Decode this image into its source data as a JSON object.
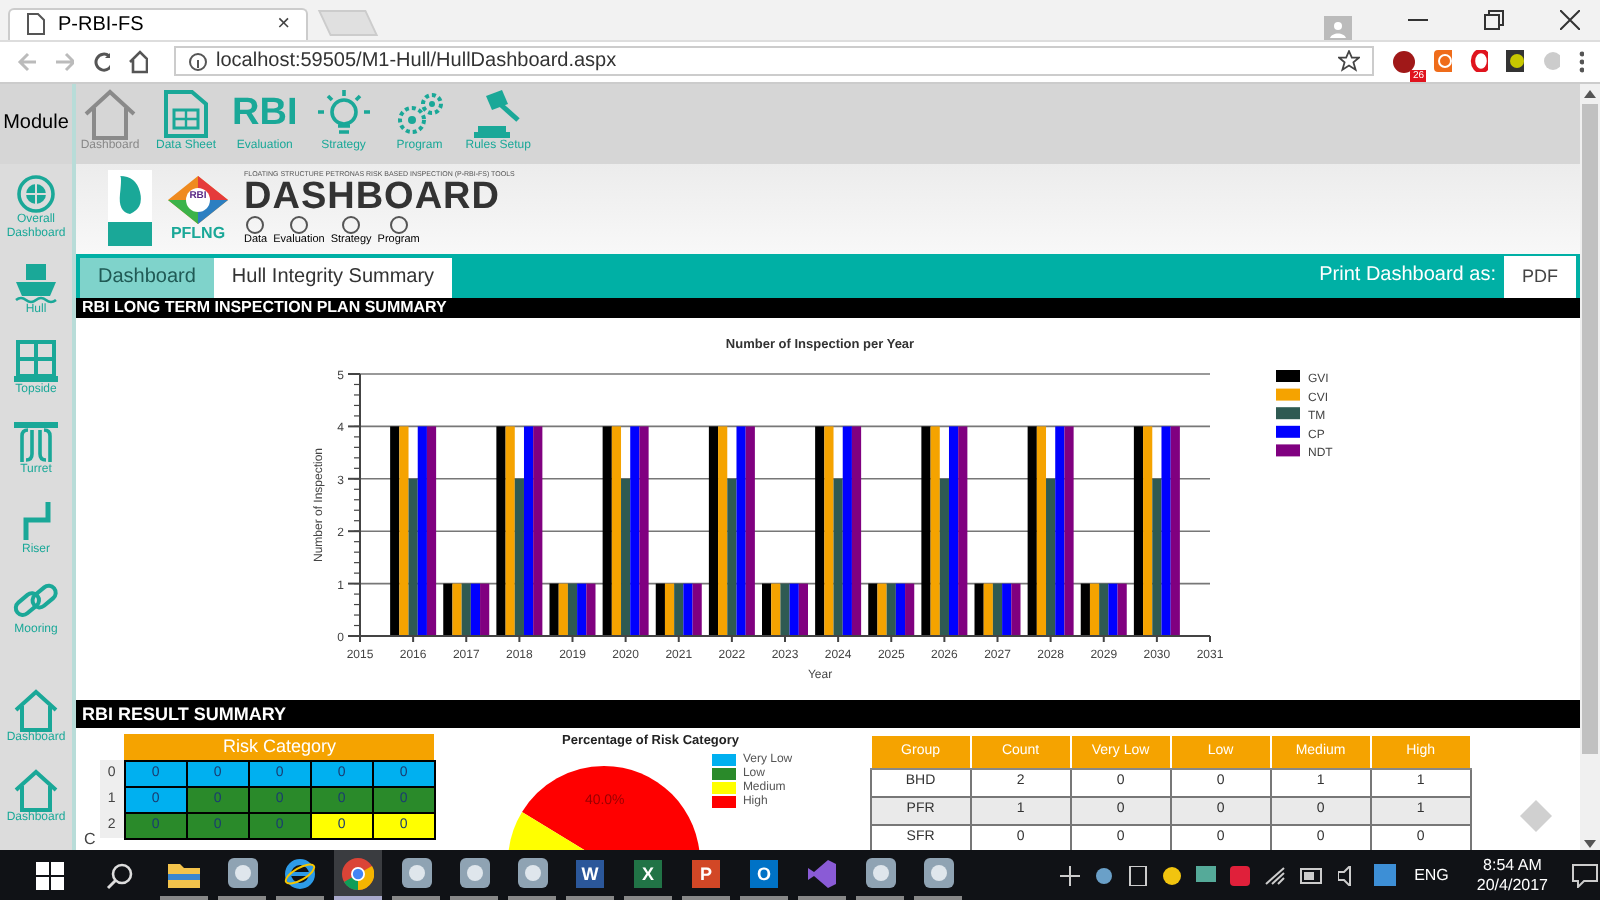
{
  "browser": {
    "tab_title": "P-RBI-FS",
    "tab_close": "×",
    "url": "localhost:59505/M1-Hull/HullDashboard.aspx",
    "extension_badge": "26"
  },
  "module_label": "Module",
  "toolbar": [
    {
      "label": "Dashboard",
      "kind": "house"
    },
    {
      "label": "Data Sheet",
      "kind": "sheet"
    },
    {
      "label": "Evaluation",
      "kind": "rbi",
      "logo_text": "RBI"
    },
    {
      "label": "Strategy",
      "kind": "bulb"
    },
    {
      "label": "Program",
      "kind": "gears"
    },
    {
      "label": "Rules Setup",
      "kind": "gavel"
    }
  ],
  "sidebar": {
    "items": [
      {
        "label": "Overall Dashboard",
        "kind": "globe"
      },
      {
        "label": "Hull",
        "kind": "ship"
      },
      {
        "label": "Topside",
        "kind": "window"
      },
      {
        "label": "Turret",
        "kind": "turret"
      },
      {
        "label": "Riser",
        "kind": "pipe"
      },
      {
        "label": "Mooring",
        "kind": "chain"
      },
      {
        "label": "Dashboard",
        "kind": "house"
      },
      {
        "label": "Dashboard",
        "kind": "house"
      }
    ]
  },
  "banner": {
    "logo_badge": "RBI",
    "logo_name": "PFLNG",
    "subtitle": "FLOATING STRUCTURE PETRONAS RISK BASED INSPECTION (P-RBI-FS) TOOLS",
    "title": "DASHBOARD",
    "steps": [
      "Data",
      "Evaluation",
      "Strategy",
      "Program"
    ]
  },
  "tabs": [
    {
      "label": "Dashboard",
      "selected": false
    },
    {
      "label": "Hull Integrity Summary",
      "selected": true
    }
  ],
  "print": {
    "label": "Print Dashboard as:",
    "button": "PDF"
  },
  "plan_section": {
    "title": "RBI LONG TERM INSPECTION PLAN SUMMARY",
    "chart_data": {
      "type": "bar",
      "title": "Number of Inspection per Year",
      "xlabel": "Year",
      "ylabel": "Number of Inspection",
      "x": [
        2016,
        2017,
        2018,
        2019,
        2020,
        2021,
        2022,
        2023,
        2024,
        2025,
        2026,
        2027,
        2028,
        2029,
        2030
      ],
      "series": [
        {
          "name": "GVI",
          "color": "#000000",
          "values": [
            4,
            1,
            4,
            1,
            4,
            1,
            4,
            1,
            4,
            1,
            4,
            1,
            4,
            1,
            4
          ]
        },
        {
          "name": "CVI",
          "color": "#f5a300",
          "values": [
            4,
            1,
            4,
            1,
            4,
            1,
            4,
            1,
            4,
            1,
            4,
            1,
            4,
            1,
            4
          ]
        },
        {
          "name": "TM",
          "color": "#2f5a52",
          "values": [
            3,
            1,
            3,
            1,
            3,
            1,
            3,
            1,
            3,
            1,
            3,
            1,
            3,
            1,
            3
          ]
        },
        {
          "name": "CP",
          "color": "#0000ff",
          "values": [
            4,
            1,
            4,
            1,
            4,
            1,
            4,
            1,
            4,
            1,
            4,
            1,
            4,
            1,
            4
          ]
        },
        {
          "name": "NDT",
          "color": "#800080",
          "values": [
            4,
            1,
            4,
            1,
            4,
            1,
            4,
            1,
            4,
            1,
            4,
            1,
            4,
            1,
            4
          ]
        }
      ],
      "xlim": [
        2015,
        2031
      ],
      "xticks": [
        2015,
        2016,
        2017,
        2018,
        2019,
        2020,
        2021,
        2022,
        2023,
        2024,
        2025,
        2026,
        2027,
        2028,
        2029,
        2030,
        2031
      ],
      "ylim": [
        0,
        5
      ],
      "yticks": [
        0,
        1,
        2,
        3,
        4,
        5
      ],
      "grid": true,
      "legend": true
    }
  },
  "result_section": {
    "title": "RBI RESULT SUMMARY",
    "risk_matrix": {
      "title": "Risk Category",
      "axis_label": "C",
      "rows": [
        {
          "label": "0",
          "cells": [
            {
              "value": "0",
              "color": "#00b0f0"
            },
            {
              "value": "0",
              "color": "#00b0f0"
            },
            {
              "value": "0",
              "color": "#00b0f0"
            },
            {
              "value": "0",
              "color": "#00b0f0"
            },
            {
              "value": "0",
              "color": "#00b0f0"
            }
          ]
        },
        {
          "label": "1",
          "cells": [
            {
              "value": "0",
              "color": "#00b0f0"
            },
            {
              "value": "0",
              "color": "#2a8a2a"
            },
            {
              "value": "0",
              "color": "#2a8a2a"
            },
            {
              "value": "0",
              "color": "#2a8a2a"
            },
            {
              "value": "0",
              "color": "#2a8a2a"
            }
          ]
        },
        {
          "label": "2",
          "cells": [
            {
              "value": "0",
              "color": "#2a8a2a"
            },
            {
              "value": "0",
              "color": "#2a8a2a"
            },
            {
              "value": "0",
              "color": "#2a8a2a"
            },
            {
              "value": "0",
              "color": "#ffff00"
            },
            {
              "value": "0",
              "color": "#ffff00"
            }
          ]
        }
      ]
    },
    "pie": {
      "title": "Percentage of Risk Category",
      "slice_label": "40.0%",
      "legend": [
        {
          "label": "Very Low",
          "color": "#00b0f0"
        },
        {
          "label": "Low",
          "color": "#2a8a2a"
        },
        {
          "label": "Medium",
          "color": "#ffff00"
        },
        {
          "label": "High",
          "color": "#ff0000"
        }
      ]
    },
    "group_table": {
      "columns": [
        "Group",
        "Count",
        "Very Low",
        "Low",
        "Medium",
        "High"
      ],
      "rows": [
        [
          "BHD",
          "2",
          "0",
          "0",
          "1",
          "1"
        ],
        [
          "PFR",
          "1",
          "0",
          "0",
          "0",
          "1"
        ],
        [
          "SFR",
          "0",
          "0",
          "0",
          "0",
          "0"
        ]
      ]
    }
  },
  "taskbar": {
    "apps": [
      {
        "kind": "folder",
        "active": false
      },
      {
        "kind": "app",
        "active": false
      },
      {
        "kind": "ie",
        "active": false
      },
      {
        "kind": "chrome",
        "active": true
      },
      {
        "kind": "app",
        "active": false
      },
      {
        "kind": "app",
        "active": false
      },
      {
        "kind": "app",
        "active": false
      },
      {
        "kind": "office",
        "glyph": "W",
        "color": "#2b579a",
        "active": false
      },
      {
        "kind": "office",
        "glyph": "X",
        "color": "#217346",
        "active": false
      },
      {
        "kind": "office",
        "glyph": "P",
        "color": "#d24726",
        "active": false
      },
      {
        "kind": "office",
        "glyph": "O",
        "color": "#0072c6",
        "active": false
      },
      {
        "kind": "vs",
        "active": false
      },
      {
        "kind": "app",
        "active": false
      },
      {
        "kind": "app",
        "active": false
      }
    ],
    "language": "ENG",
    "time": "8:54 AM",
    "date": "20/4/2017"
  }
}
